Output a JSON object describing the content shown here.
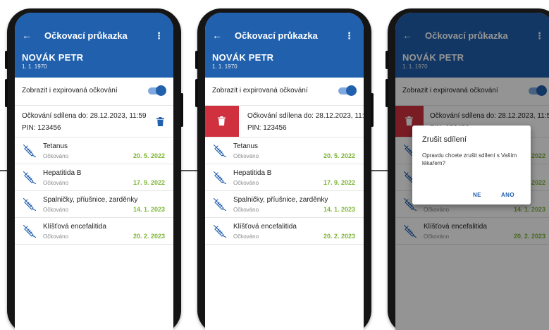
{
  "app": {
    "back_glyph": "←",
    "menu_glyph": "⋮",
    "title": "Očkovací průkazka",
    "patient_name": "NOVÁK PETR",
    "patient_dob": "1. 1. 1970"
  },
  "toggle": {
    "label": "Zobrazit i expirovaná očkování",
    "state": "on"
  },
  "share": {
    "line1": "Očkování sdílena do: 28.12.2023, 11:59",
    "line2": "PIN: 123456"
  },
  "vaccinations": [
    {
      "name": "Tetanus",
      "status": "Očkováno",
      "date": "20. 5. 2022"
    },
    {
      "name": "Hepatitida B",
      "status": "Očkováno",
      "date": "17. 9. 2022"
    },
    {
      "name": "Spalničky, příušnice, zarděnky",
      "status": "Očkováno",
      "date": "14. 1. 2023"
    },
    {
      "name": "Klíšťová encefalitida",
      "status": "Očkováno",
      "date": "20. 2. 2023"
    }
  ],
  "dialog": {
    "title": "Zrušit sdílení",
    "body": "Opravdu chcete zrušit sdílení s Vaším lékařem?",
    "no_label": "NE",
    "yes_label": "ANO"
  },
  "colors": {
    "primary": "#2060ad",
    "danger": "#d0313f",
    "date_green": "#7cb536"
  }
}
